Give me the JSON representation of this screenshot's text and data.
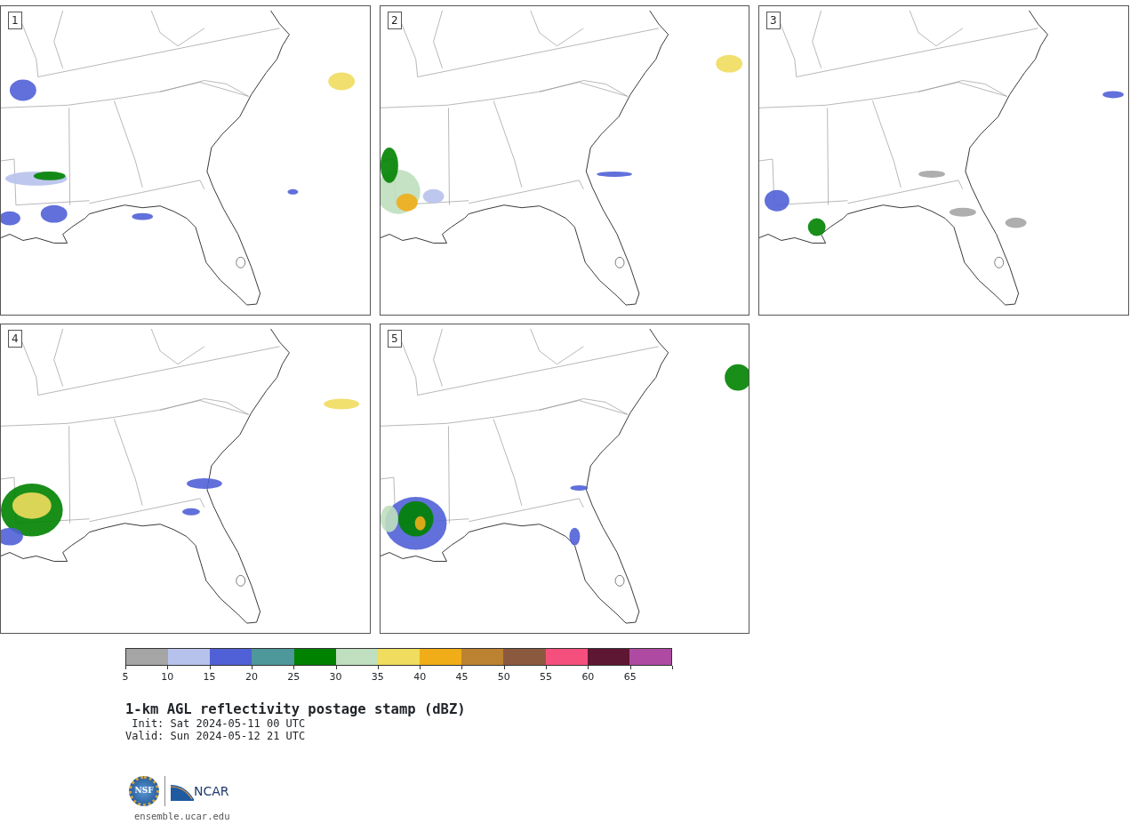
{
  "panels": [
    {
      "label": "1"
    },
    {
      "label": "2"
    },
    {
      "label": "3"
    },
    {
      "label": "4"
    },
    {
      "label": "5"
    }
  ],
  "colorbar": {
    "segments": [
      {
        "color": "#a5a5a5"
      },
      {
        "color": "#b7c2ec"
      },
      {
        "color": "#5060d6"
      },
      {
        "color": "#4e979b"
      },
      {
        "color": "#008200"
      },
      {
        "color": "#bfdfbf"
      },
      {
        "color": "#f0dc5e"
      },
      {
        "color": "#f0ad18"
      },
      {
        "color": "#bb8231"
      },
      {
        "color": "#8b5a3e"
      },
      {
        "color": "#f5507d"
      },
      {
        "color": "#5e1733"
      },
      {
        "color": "#ae4aa2"
      }
    ],
    "ticks": [
      "5",
      "10",
      "15",
      "20",
      "25",
      "30",
      "35",
      "40",
      "45",
      "50",
      "55",
      "60",
      "65"
    ]
  },
  "title": "1-km AGL reflectivity postage stamp (dBZ)",
  "init": " Init: Sat 2024-05-11 00 UTC",
  "valid": "Valid: Sun 2024-05-12 21 UTC",
  "logo": {
    "nsf": "NSF",
    "ncar": "NCAR"
  },
  "url": "ensemble.ucar.edu"
}
